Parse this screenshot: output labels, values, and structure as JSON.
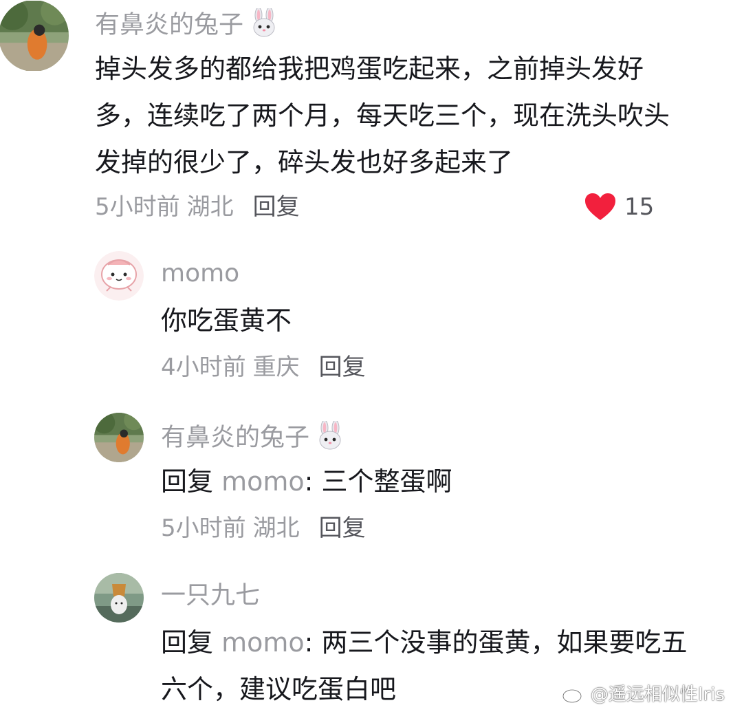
{
  "comments": [
    {
      "username": "有鼻炎的兔子",
      "emoji": "rabbit-face-icon",
      "lines": [
        "掉头发多的都给我把鸡蛋吃起来，之前掉头发好",
        "多，连续吃了两个月，每天吃三个，现在洗头吹头",
        "发掉的很少了，碎头发也好多起来了"
      ],
      "time": "5小时前",
      "location": "湖北",
      "reply_label": "回复",
      "like_count": "15"
    }
  ],
  "replies": [
    {
      "username": "momo",
      "text": "你吃蛋黄不",
      "time": "4小时前",
      "location": "重庆",
      "reply_label": "回复"
    },
    {
      "username": "有鼻炎的兔子",
      "emoji": "rabbit-face-icon",
      "reply_prefix": "回复 ",
      "reply_to": "momo",
      "text": ": 三个整蛋啊",
      "time": "5小时前",
      "location": "湖北",
      "reply_label": "回复"
    },
    {
      "username": "一只九七",
      "reply_prefix": "回复 ",
      "reply_to": "momo",
      "text_line1": ": 两三个没事的蛋黄，如果要吃五",
      "text_line2": "六个，建议吃蛋白吧"
    }
  ],
  "watermark": {
    "text": "@遥远相似性Iris",
    "icon": "weibo-logo-icon"
  },
  "colors": {
    "like_heart": "#f2203d",
    "secondary_text": "#9a9ba0",
    "primary_text": "#17181d"
  }
}
